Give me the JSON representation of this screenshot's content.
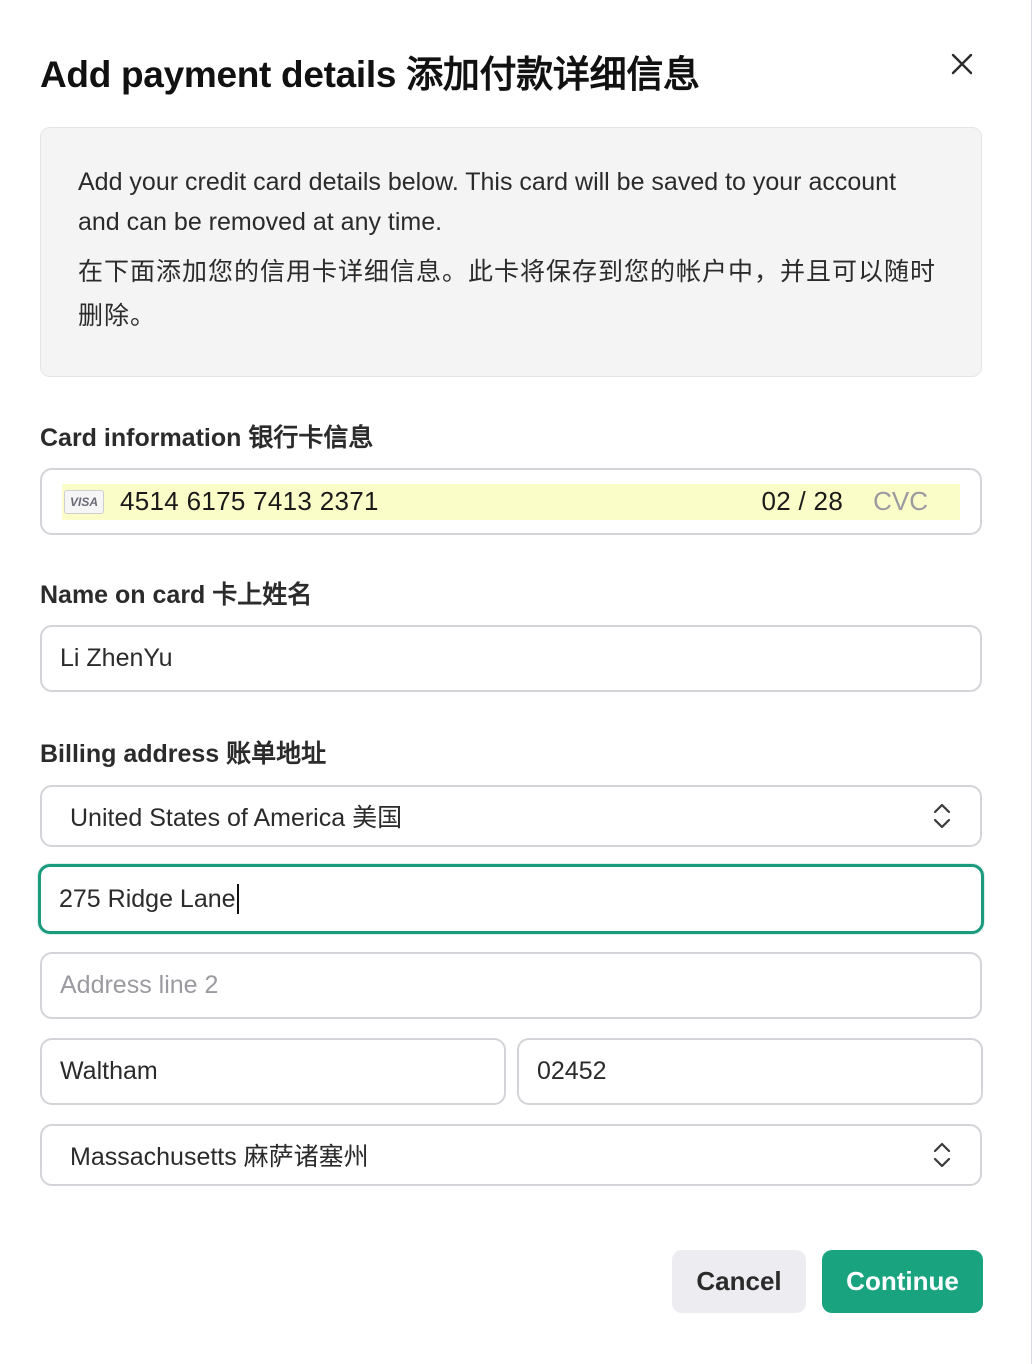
{
  "dialog": {
    "title": "Add payment details 添加付款详细信息",
    "info_en": "Add your credit card details below. This card will be saved to your account and can be removed at any time.",
    "info_zh": "在下面添加您的信用卡详细信息。此卡将保存到您的帐户中，并且可以随时删除。"
  },
  "card": {
    "label": "Card information 银行卡信息",
    "brand": "VISA",
    "number": "4514 6175 7413 2371",
    "expiry": "02 / 28",
    "cvc_placeholder": "CVC"
  },
  "name": {
    "label": "Name on card 卡上姓名",
    "value": "Li ZhenYu"
  },
  "billing": {
    "label": "Billing address 账单地址",
    "country": "United States of America 美国",
    "address_line1": "275 Ridge Lane",
    "address_line2_placeholder": "Address line 2",
    "city": "Waltham",
    "postal_code": "02452",
    "state": "Massachusetts 麻萨诸塞州"
  },
  "actions": {
    "cancel": "Cancel",
    "continue": "Continue"
  },
  "colors": {
    "accent": "#19a37f",
    "focus_border": "#1a9b7d",
    "autofill_highlight": "#fbfdc8"
  },
  "icons": {
    "close": "close-icon",
    "select": "chevron-up-down-icon"
  }
}
